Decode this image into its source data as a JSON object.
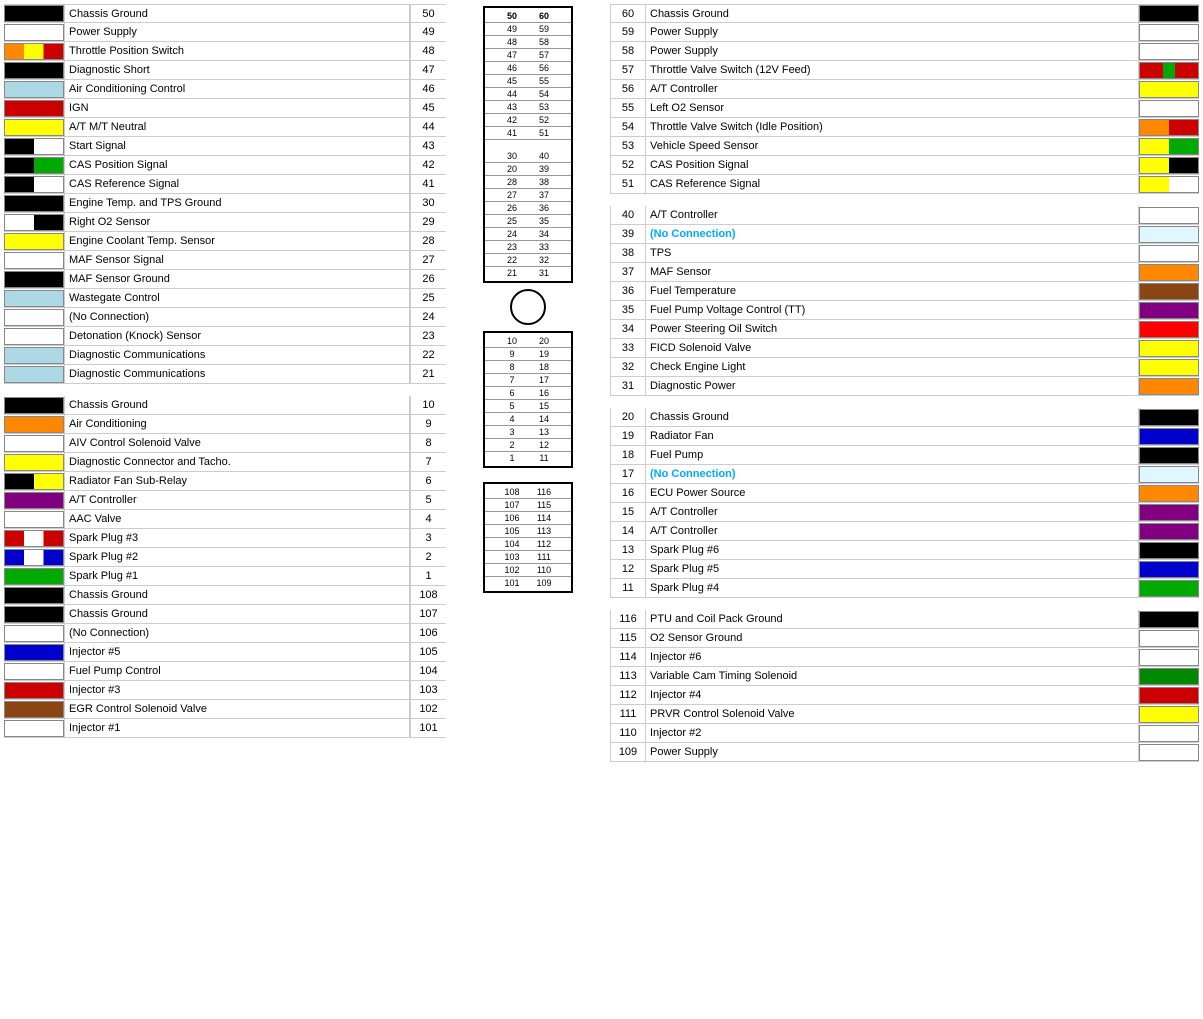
{
  "left": {
    "rows": [
      {
        "swatch": "#000000",
        "label": "Chassis Ground",
        "pin": "50"
      },
      {
        "swatch": "#ffffff",
        "label": "Power Supply",
        "pin": "49"
      },
      {
        "swatch": "#ff4400",
        "label": "Throttle Position Switch",
        "pin": "48"
      },
      {
        "swatch": "#000000",
        "label": "Diagnostic Short",
        "pin": "47"
      },
      {
        "swatch": "#add8e6",
        "label": "Air Conditioning Control",
        "pin": "46"
      },
      {
        "swatch": "#cc0000",
        "label": "IGN",
        "pin": "45"
      },
      {
        "swatch": "#ffff00",
        "label": "A/T M/T Neutral",
        "pin": "44"
      },
      {
        "swatch": "#000000",
        "label": "Start Signal",
        "pin": "43"
      },
      {
        "swatch": "#000000",
        "label": "CAS Position Signal",
        "pin": "42"
      },
      {
        "swatch": "#000000",
        "label": "CAS Reference Signal",
        "pin": "41"
      },
      {
        "swatch": "#000000",
        "label": "Engine Temp. and TPS Ground",
        "pin": "30"
      },
      {
        "swatch": "#ffffff",
        "label": "Right O2 Sensor",
        "pin": "29"
      },
      {
        "swatch": "#ffff00",
        "label": "Engine Coolant Temp. Sensor",
        "pin": "28"
      },
      {
        "swatch": "#ffffff",
        "label": "MAF Sensor Signal",
        "pin": "27"
      },
      {
        "swatch": "#000000",
        "label": "MAF Sensor Ground",
        "pin": "26"
      },
      {
        "swatch": "#add8e6",
        "label": "Wastegate Control",
        "pin": "25"
      },
      {
        "swatch": "#ffffff",
        "label": "(No Connection)",
        "pin": "24"
      },
      {
        "swatch": "#ffffff",
        "label": "Detonation (Knock) Sensor",
        "pin": "23"
      },
      {
        "swatch": "#add8e6",
        "label": "Diagnostic Communications",
        "pin": "22"
      },
      {
        "swatch": "#add8e6",
        "label": "Diagnostic Communications",
        "pin": "21"
      },
      {
        "swatch": "",
        "label": "",
        "pin": ""
      },
      {
        "swatch": "#000000",
        "label": "Chassis Ground",
        "pin": "10"
      },
      {
        "swatch": "#ff8800",
        "label": "Air Conditioning",
        "pin": "9"
      },
      {
        "swatch": "#ffffff",
        "label": "AIV Control Solenoid Valve",
        "pin": "8"
      },
      {
        "swatch": "#ffff00",
        "label": "Diagnostic Connector and Tacho.",
        "pin": "7"
      },
      {
        "swatch": "#ffffff",
        "label": "Radiator Fan Sub-Relay",
        "pin": "6"
      },
      {
        "swatch": "#800080",
        "label": "A/T Controller",
        "pin": "5"
      },
      {
        "swatch": "#ffffff",
        "label": "AAC Valve",
        "pin": "4"
      },
      {
        "swatch": "#cc0000",
        "label": "Spark Plug #3",
        "pin": "3"
      },
      {
        "swatch": "#0000cc",
        "label": "Spark Plug #2",
        "pin": "2"
      },
      {
        "swatch": "#00aa00",
        "label": "Spark Plug #1",
        "pin": "1"
      },
      {
        "swatch": "#000000",
        "label": "Chassis Ground",
        "pin": "108"
      },
      {
        "swatch": "#000000",
        "label": "Chassis Ground",
        "pin": "107"
      },
      {
        "swatch": "#ffffff",
        "label": "(No Connection)",
        "pin": "106"
      },
      {
        "swatch": "#0000cc",
        "label": "Injector #5",
        "pin": "105"
      },
      {
        "swatch": "#ffffff",
        "label": "Fuel Pump Control",
        "pin": "104"
      },
      {
        "swatch": "#cc0000",
        "label": "Injector #3",
        "pin": "103"
      },
      {
        "swatch": "#8B4513",
        "label": "EGR Control Solenoid Valve",
        "pin": "102"
      },
      {
        "swatch": "#ffffff",
        "label": "Injector #1",
        "pin": "101"
      }
    ]
  },
  "center": {
    "top_pairs": [
      [
        "50",
        "60"
      ],
      [
        "49",
        "59"
      ],
      [
        "48",
        "58"
      ],
      [
        "47",
        "57"
      ],
      [
        "46",
        "56"
      ],
      [
        "45",
        "55"
      ],
      [
        "44",
        "54"
      ],
      [
        "43",
        "53"
      ],
      [
        "42",
        "52"
      ],
      [
        "41",
        "51"
      ],
      [
        "30",
        "40"
      ],
      [
        "20",
        "39"
      ],
      [
        "28",
        "38"
      ],
      [
        "27",
        "37"
      ],
      [
        "26",
        "36"
      ],
      [
        "25",
        "35"
      ],
      [
        "24",
        "34"
      ],
      [
        "23",
        "33"
      ],
      [
        "22",
        "32"
      ],
      [
        "21",
        "31"
      ]
    ],
    "bottom_pairs": [
      [
        "10",
        "20"
      ],
      [
        "9",
        "19"
      ],
      [
        "8",
        "18"
      ],
      [
        "7",
        "17"
      ],
      [
        "6",
        "16"
      ],
      [
        "5",
        "15"
      ],
      [
        "4",
        "14"
      ],
      [
        "3",
        "13"
      ],
      [
        "2",
        "12"
      ],
      [
        "1",
        "11"
      ]
    ],
    "lower_pairs": [
      [
        "108",
        "116"
      ],
      [
        "107",
        "115"
      ],
      [
        "106",
        "114"
      ],
      [
        "105",
        "113"
      ],
      [
        "104",
        "112"
      ],
      [
        "103",
        "111"
      ],
      [
        "102",
        "110"
      ],
      [
        "101",
        "109"
      ]
    ]
  },
  "right": {
    "rows": [
      {
        "pin": "60",
        "label": "Chassis Ground",
        "swatch": "#000000"
      },
      {
        "pin": "59",
        "label": "Power Supply",
        "swatch": "#ffffff"
      },
      {
        "pin": "58",
        "label": "Power Supply",
        "swatch": "#ffffff"
      },
      {
        "pin": "57",
        "label": "Throttle Valve Switch (12V Feed)",
        "swatch": "#cc0000"
      },
      {
        "pin": "56",
        "label": "A/T Controller",
        "swatch": "#ffff00"
      },
      {
        "pin": "55",
        "label": "Left O2 Sensor",
        "swatch": "#ffffff"
      },
      {
        "pin": "54",
        "label": "Throttle Valve Switch (Idle Position)",
        "swatch": "#cc0000"
      },
      {
        "pin": "53",
        "label": "Vehicle Speed Sensor",
        "swatch": "#ffff00"
      },
      {
        "pin": "52",
        "label": "CAS Position Signal",
        "swatch": "#ffff00"
      },
      {
        "pin": "51",
        "label": "CAS Reference Signal",
        "swatch": "#ffff00"
      },
      {
        "pin": "40",
        "label": "A/T Controller",
        "swatch": "#ffffff"
      },
      {
        "pin": "39",
        "label": "(No Connection)",
        "swatch": "nc"
      },
      {
        "pin": "38",
        "label": "TPS",
        "swatch": "#ffffff"
      },
      {
        "pin": "37",
        "label": "MAF Sensor",
        "swatch": "#ff8800"
      },
      {
        "pin": "36",
        "label": "Fuel Temperature",
        "swatch": "#8B4513"
      },
      {
        "pin": "35",
        "label": "Fuel Pump Voltage Control (TT)",
        "swatch": "#800080"
      },
      {
        "pin": "34",
        "label": "Power Steering Oil Switch",
        "swatch": "#ff0000"
      },
      {
        "pin": "33",
        "label": "FICD Solenoid Valve",
        "swatch": "#ffff00"
      },
      {
        "pin": "32",
        "label": "Check Engine Light",
        "swatch": "#ffff00"
      },
      {
        "pin": "31",
        "label": "Diagnostic Power",
        "swatch": "#ff8800"
      },
      {
        "pin": "20",
        "label": "Chassis Ground",
        "swatch": "#000000"
      },
      {
        "pin": "19",
        "label": "Radiator Fan",
        "swatch": "#0000cc"
      },
      {
        "pin": "18",
        "label": "Fuel Pump",
        "swatch": "#000000"
      },
      {
        "pin": "17",
        "label": "(No Connection)",
        "swatch": "nc"
      },
      {
        "pin": "16",
        "label": "ECU Power Source",
        "swatch": "#ff8800"
      },
      {
        "pin": "15",
        "label": "A/T Controller",
        "swatch": "#800080"
      },
      {
        "pin": "14",
        "label": "A/T Controller",
        "swatch": "#800080"
      },
      {
        "pin": "13",
        "label": "Spark Plug #6",
        "swatch": "#000000"
      },
      {
        "pin": "12",
        "label": "Spark Plug #5",
        "swatch": "#0000cc"
      },
      {
        "pin": "11",
        "label": "Spark Plug #4",
        "swatch": "#00aa00"
      },
      {
        "pin": "116",
        "label": "PTU and Coil Pack Ground",
        "swatch": "#000000"
      },
      {
        "pin": "115",
        "label": "O2 Sensor Ground",
        "swatch": "#ffffff"
      },
      {
        "pin": "114",
        "label": "Injector #6",
        "swatch": "#ffffff"
      },
      {
        "pin": "113",
        "label": "Variable Cam Timing Solenoid",
        "swatch": "#008800"
      },
      {
        "pin": "112",
        "label": "Injector #4",
        "swatch": "#cc0000"
      },
      {
        "pin": "111",
        "label": "PRVR Control Solenoid Valve",
        "swatch": "#ffff00"
      },
      {
        "pin": "110",
        "label": "Injector #2",
        "swatch": "#ffffff"
      },
      {
        "pin": "109",
        "label": "Power Supply",
        "swatch": "#ffffff"
      }
    ]
  }
}
